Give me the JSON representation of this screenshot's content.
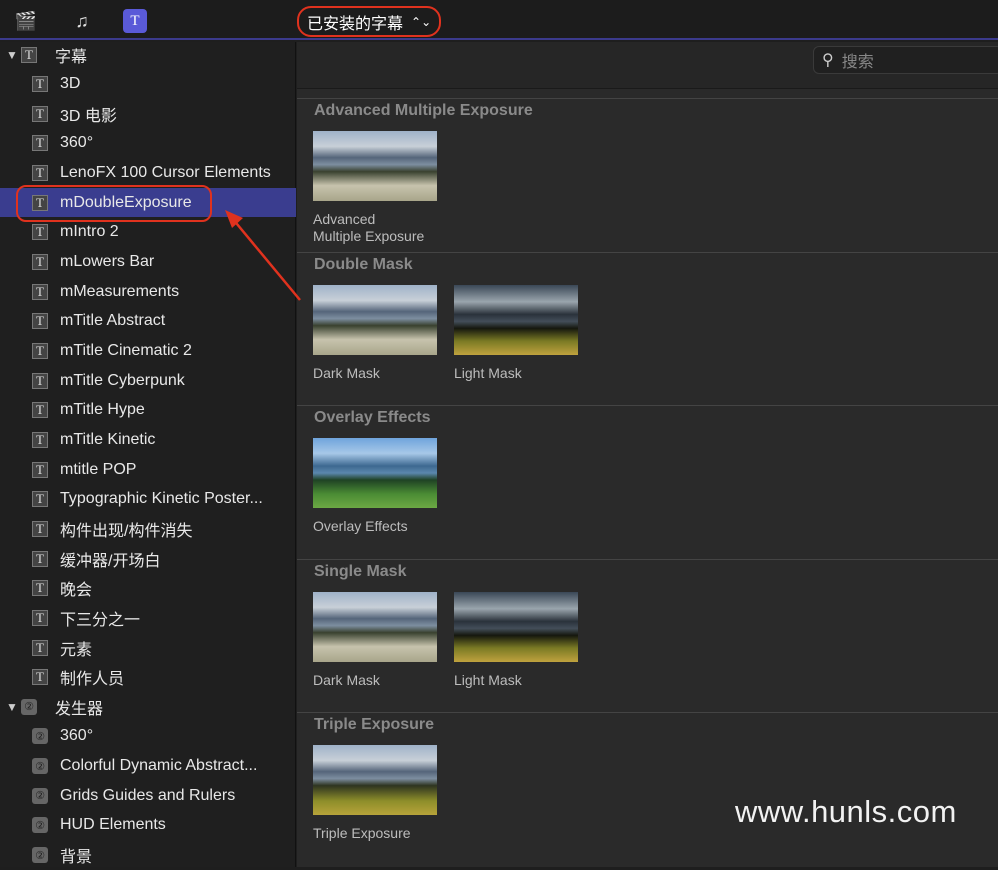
{
  "toolbar": {
    "icons": [
      "clapper-star-icon",
      "music-photo-icon",
      "titles-generators-icon"
    ],
    "picker_label": "已安装的字幕",
    "accent": "#3b3a8c",
    "highlight": "#e0321e"
  },
  "sidebar": {
    "titles_header": "字幕",
    "titles": [
      "3D",
      "3D 电影",
      "360°",
      "LenoFX 100 Cursor Elements",
      "mDoubleExposure",
      "mIntro 2",
      "mLowers Bar",
      "mMeasurements",
      "mTitle Abstract",
      "mTitle Cinematic 2",
      "mTitle Cyberpunk",
      "mTitle Hype",
      "mTitle Kinetic",
      "mtitle POP",
      "Typographic Kinetic Poster...",
      "构件出现/构件消失",
      "缓冲器/开场白",
      "晚会",
      "下三分之一",
      "元素",
      "制作人员"
    ],
    "selected": "mDoubleExposure",
    "generators_header": "发生器",
    "generators": [
      "360°",
      "Colorful Dynamic Abstract...",
      "Grids Guides and Rulers",
      "HUD Elements",
      "背景"
    ]
  },
  "search": {
    "placeholder": "搜索"
  },
  "sections": [
    {
      "title": "Advanced Multiple Exposure",
      "items": [
        {
          "label": "Advanced\nMultiple Exposure",
          "style": "normal"
        }
      ]
    },
    {
      "title": "Double Mask",
      "items": [
        {
          "label": "Dark Mask",
          "style": "normal"
        },
        {
          "label": "Light Mask",
          "style": "dark"
        }
      ]
    },
    {
      "title": "Overlay Effects",
      "items": [
        {
          "label": "Overlay Effects",
          "style": "blue"
        }
      ]
    },
    {
      "title": "Single Mask",
      "items": [
        {
          "label": "Dark Mask",
          "style": "normal"
        },
        {
          "label": "Light Mask",
          "style": "dark"
        }
      ]
    },
    {
      "title": "Triple Exposure",
      "items": [
        {
          "label": "Triple Exposure",
          "style": "yel"
        }
      ]
    }
  ],
  "watermark": "www.hunls.com"
}
